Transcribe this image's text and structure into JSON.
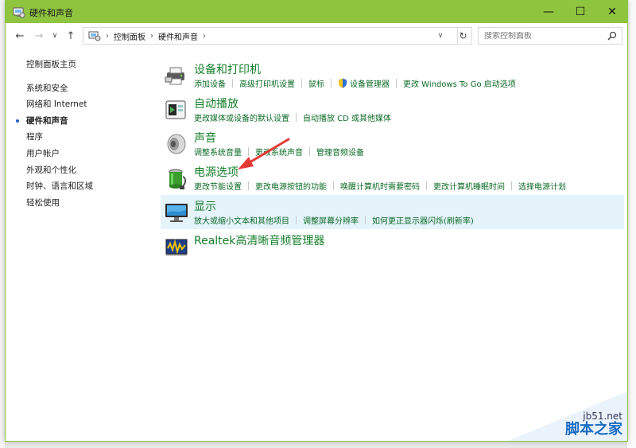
{
  "window": {
    "title": "硬件和声音"
  },
  "titlebar_buttons": {
    "minimize": "—",
    "maximize": "☐",
    "close": "✕"
  },
  "nav": {
    "back": "←",
    "forward": "→",
    "recent": "∨",
    "up": "↑"
  },
  "address": {
    "crumbs": [
      "控制面板",
      "硬件和声音"
    ],
    "separator": "›",
    "dropdown": "∨",
    "refresh": "↻"
  },
  "search": {
    "placeholder": "搜索控制面板"
  },
  "sidebar": {
    "home": "控制面板主页",
    "items": [
      {
        "label": "系统和安全"
      },
      {
        "label": "网络和 Internet"
      },
      {
        "label": "硬件和声音",
        "current": true
      },
      {
        "label": "程序"
      },
      {
        "label": "用户帐户"
      },
      {
        "label": "外观和个性化"
      },
      {
        "label": "时钟、语言和区域"
      },
      {
        "label": "轻松使用"
      }
    ]
  },
  "categories": [
    {
      "title": "设备和打印机",
      "icon": "printer-icon",
      "links": [
        "添加设备",
        "高级打印机设置",
        "鼠标",
        "设备管理器",
        "更改 Windows To Go 启动选项"
      ]
    },
    {
      "title": "自动播放",
      "icon": "autoplay-icon",
      "links": [
        "更改媒体或设备的默认设置",
        "自动播放 CD 或其他媒体"
      ]
    },
    {
      "title": "声音",
      "icon": "speaker-icon",
      "links": [
        "调整系统音量",
        "更改系统声音",
        "管理音频设备"
      ]
    },
    {
      "title": "电源选项",
      "icon": "battery-icon",
      "links": [
        "更改节能设置",
        "更改电源按钮的功能",
        "唤醒计算机时需要密码",
        "更改计算机睡眠时间",
        "选择电源计划"
      ]
    },
    {
      "title": "显示",
      "icon": "monitor-icon",
      "links": [
        "放大或缩小文本和其他项目",
        "调整屏幕分辨率",
        "如何更正显示器闪烁(刷新率)"
      ]
    },
    {
      "title": "Realtek高清晰音频管理器",
      "icon": "realtek-audio-icon",
      "links": []
    }
  ],
  "watermark": {
    "site": "jb51.net",
    "name": "脚本之家"
  },
  "colors": {
    "titlebar": "#8fc43f",
    "category_title": "#137e28",
    "link": "#0b6a25",
    "highlight": "#e5f3fb",
    "arrow": "#e53935"
  }
}
